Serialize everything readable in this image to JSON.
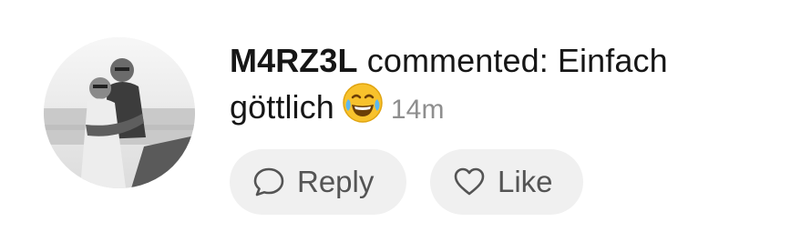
{
  "notification": {
    "username": "M4RZ3L",
    "action_text": " commented: Einfach göttlich",
    "emoji": "face-with-tears-of-joy",
    "time": "14m"
  },
  "actions": {
    "reply_label": "Reply",
    "like_label": "Like"
  },
  "avatar": {
    "icon": "user-photo-grayscale"
  },
  "colors": {
    "text": "#161616",
    "muted": "#8e8e8e",
    "button_bg": "#f0f0f0",
    "button_text": "#545454"
  }
}
